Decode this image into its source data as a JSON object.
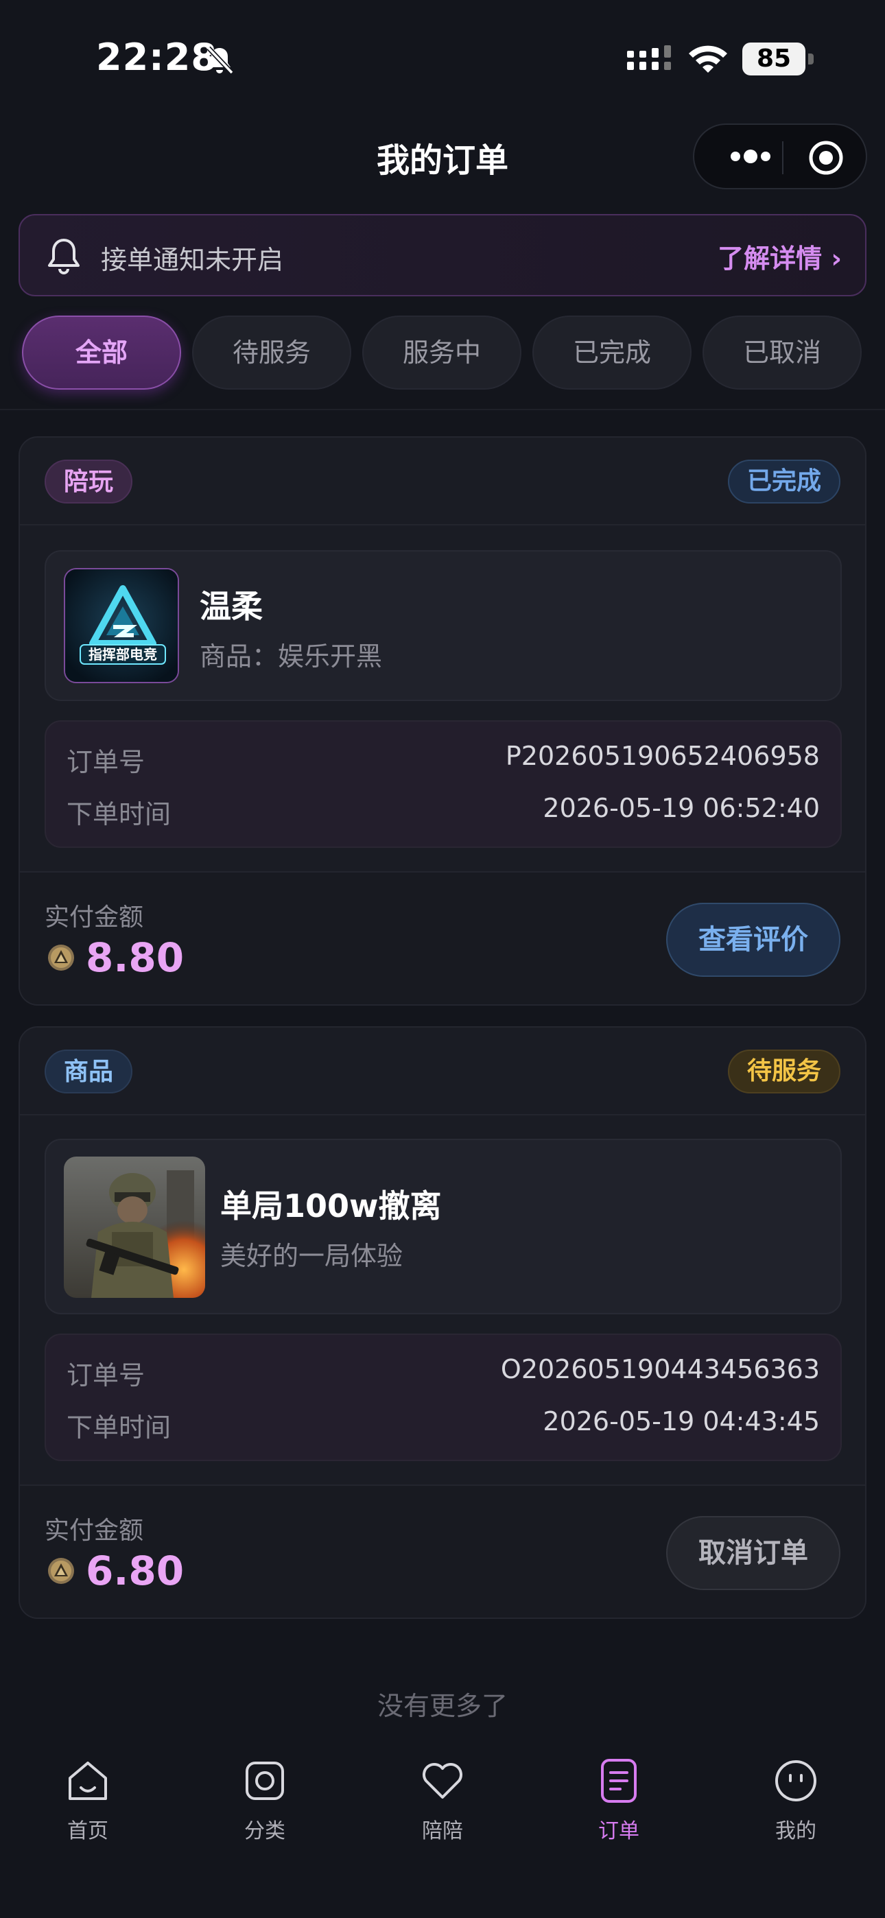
{
  "status_bar": {
    "time": "22:28",
    "battery": "85"
  },
  "nav": {
    "title": "我的订单"
  },
  "notice": {
    "text": "接单通知未开启",
    "link": "了解详情 ›"
  },
  "tabs": [
    {
      "label": "全部",
      "active": true
    },
    {
      "label": "待服务",
      "active": false
    },
    {
      "label": "服务中",
      "active": false
    },
    {
      "label": "已完成",
      "active": false
    },
    {
      "label": "已取消",
      "active": false
    }
  ],
  "orders": [
    {
      "tag": "陪玩",
      "status": "已完成",
      "product_title": "温柔",
      "product_sub": "商品：娱乐开黑",
      "thumb_text": "指挥部电竞",
      "order_no_label": "订单号",
      "order_no": "P202605190652406958",
      "time_label": "下单时间",
      "time": "2026-05-19 06:52:40",
      "paid_label": "实付金额",
      "price": "8.80",
      "action": "查看评价"
    },
    {
      "tag": "商品",
      "status": "待服务",
      "product_title": "单局100w撤离",
      "product_sub": "美好的一局体验",
      "order_no_label": "订单号",
      "order_no": "O202605190443456363",
      "time_label": "下单时间",
      "time": "2026-05-19 04:43:45",
      "paid_label": "实付金额",
      "price": "6.80",
      "action": "取消订单"
    }
  ],
  "no_more": "没有更多了",
  "tabbar": [
    {
      "label": "首页",
      "icon": "home-icon"
    },
    {
      "label": "分类",
      "icon": "category-icon"
    },
    {
      "label": "陪陪",
      "icon": "heart-icon"
    },
    {
      "label": "订单",
      "icon": "order-icon",
      "active": true
    },
    {
      "label": "我的",
      "icon": "profile-icon"
    }
  ],
  "colors": {
    "accent": "#d77cf0",
    "background": "#13151c",
    "price": "#e9a5f4"
  }
}
